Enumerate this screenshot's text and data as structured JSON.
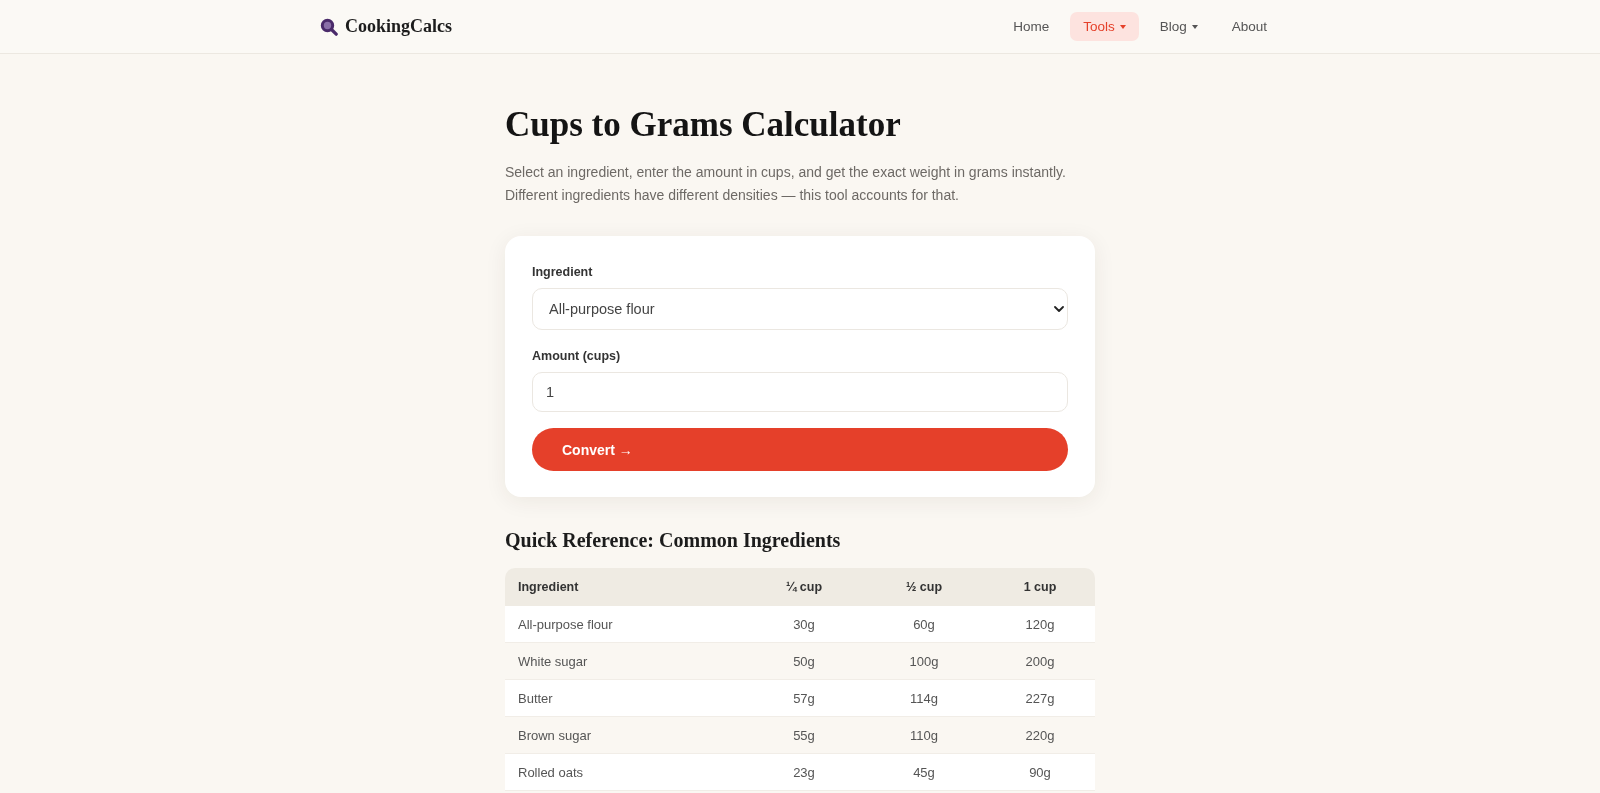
{
  "header": {
    "logo": "CookingCalcs",
    "nav": [
      {
        "label": "Home",
        "selected": false,
        "dropdown": false
      },
      {
        "label": "Tools",
        "selected": true,
        "dropdown": true
      },
      {
        "label": "Blog",
        "selected": false,
        "dropdown": true
      },
      {
        "label": "About",
        "selected": false,
        "dropdown": false
      }
    ]
  },
  "intro": {
    "title": "Cups to Grams Calculator",
    "text": "Select an ingredient, enter the amount in cups, and get the exact weight in grams instantly. Different ingredients have different densities — this tool accounts for that."
  },
  "converter": {
    "fields": [
      {
        "kind": "select",
        "label": "Ingredient",
        "value": "All-purpose flour"
      },
      {
        "kind": "input",
        "label": "Amount (cups)",
        "value": "1"
      }
    ],
    "button": "Convert →"
  },
  "reference": {
    "title": "Quick Reference: Common Ingredients",
    "columns": [
      "Ingredient",
      "¼ cup",
      "½ cup",
      "1 cup"
    ],
    "rows": [
      [
        "All-purpose flour",
        "30g",
        "60g",
        "120g"
      ],
      [
        "White sugar",
        "50g",
        "100g",
        "200g"
      ],
      [
        "Butter",
        "57g",
        "114g",
        "227g"
      ],
      [
        "Brown sugar",
        "55g",
        "110g",
        "220g"
      ],
      [
        "Rolled oats",
        "23g",
        "45g",
        "90g"
      ]
    ]
  }
}
